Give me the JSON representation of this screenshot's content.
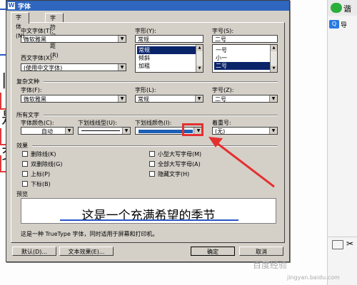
{
  "dialog": {
    "title": "字体",
    "title_icon": "W",
    "tabs": [
      {
        "label": "字体(N)"
      },
      {
        "label": "字符间距(R)"
      }
    ],
    "chinese_font": {
      "label": "中文字体(T):",
      "value": "微软雅黑"
    },
    "western_font": {
      "label": "西文字体(X):",
      "value": "(使用中文字体)"
    },
    "style": {
      "label": "字形(Y):",
      "value": "常规",
      "options": [
        "常规",
        "倾斜",
        "加粗"
      ],
      "selected": 0
    },
    "size": {
      "label": "字号(S):",
      "value": "二号",
      "options": [
        "一号",
        "小一",
        "二号"
      ],
      "selected": 2
    },
    "complex": {
      "group": "复杂文种",
      "font_label": "字体(F):",
      "font_value": "微软雅黑",
      "style_label": "字形(L):",
      "style_value": "常规",
      "size_label": "字号(Z):",
      "size_value": "二号"
    },
    "all_text": {
      "group": "所有文字",
      "font_color_label": "字体颜色(C):",
      "font_color_value": "自动",
      "underline_type_label": "下划线线型(U):",
      "underline_color_label": "下划线颜色(I):",
      "underline_color_hex": "#1c5fb5",
      "emphasis_label": "着重号:",
      "emphasis_value": "(无)"
    },
    "effects": {
      "group": "效果",
      "items": [
        {
          "label": "删除线(K)"
        },
        {
          "label": "双删除线(G)"
        },
        {
          "label": "上标(P)"
        },
        {
          "label": "下标(B)"
        },
        {
          "label": "小型大写字母(M)"
        },
        {
          "label": "全部大写字母(A)"
        },
        {
          "label": "隐藏文字(H)"
        }
      ]
    },
    "preview": {
      "group": "预览",
      "text": "这是一个充满希望的季节",
      "description": "这是一种 TrueType 字体，同时适用于屏幕和打印机。"
    },
    "buttons": {
      "default": "默认(D)...",
      "text_effects": "文本效果(E)...",
      "ok": "确定",
      "cancel": "取消"
    }
  },
  "side_panel": {
    "title": "谐",
    "item": "导"
  },
  "document": {
    "chars": [
      "|",
      "b",
      "是",
      "交"
    ]
  },
  "watermark": {
    "text": "百度经验",
    "sub": "jingyan.baidu.com"
  },
  "colors": {
    "accent": "#2e66c0",
    "highlight": "#e43030",
    "dialog_bg": "#d4d0c8"
  }
}
